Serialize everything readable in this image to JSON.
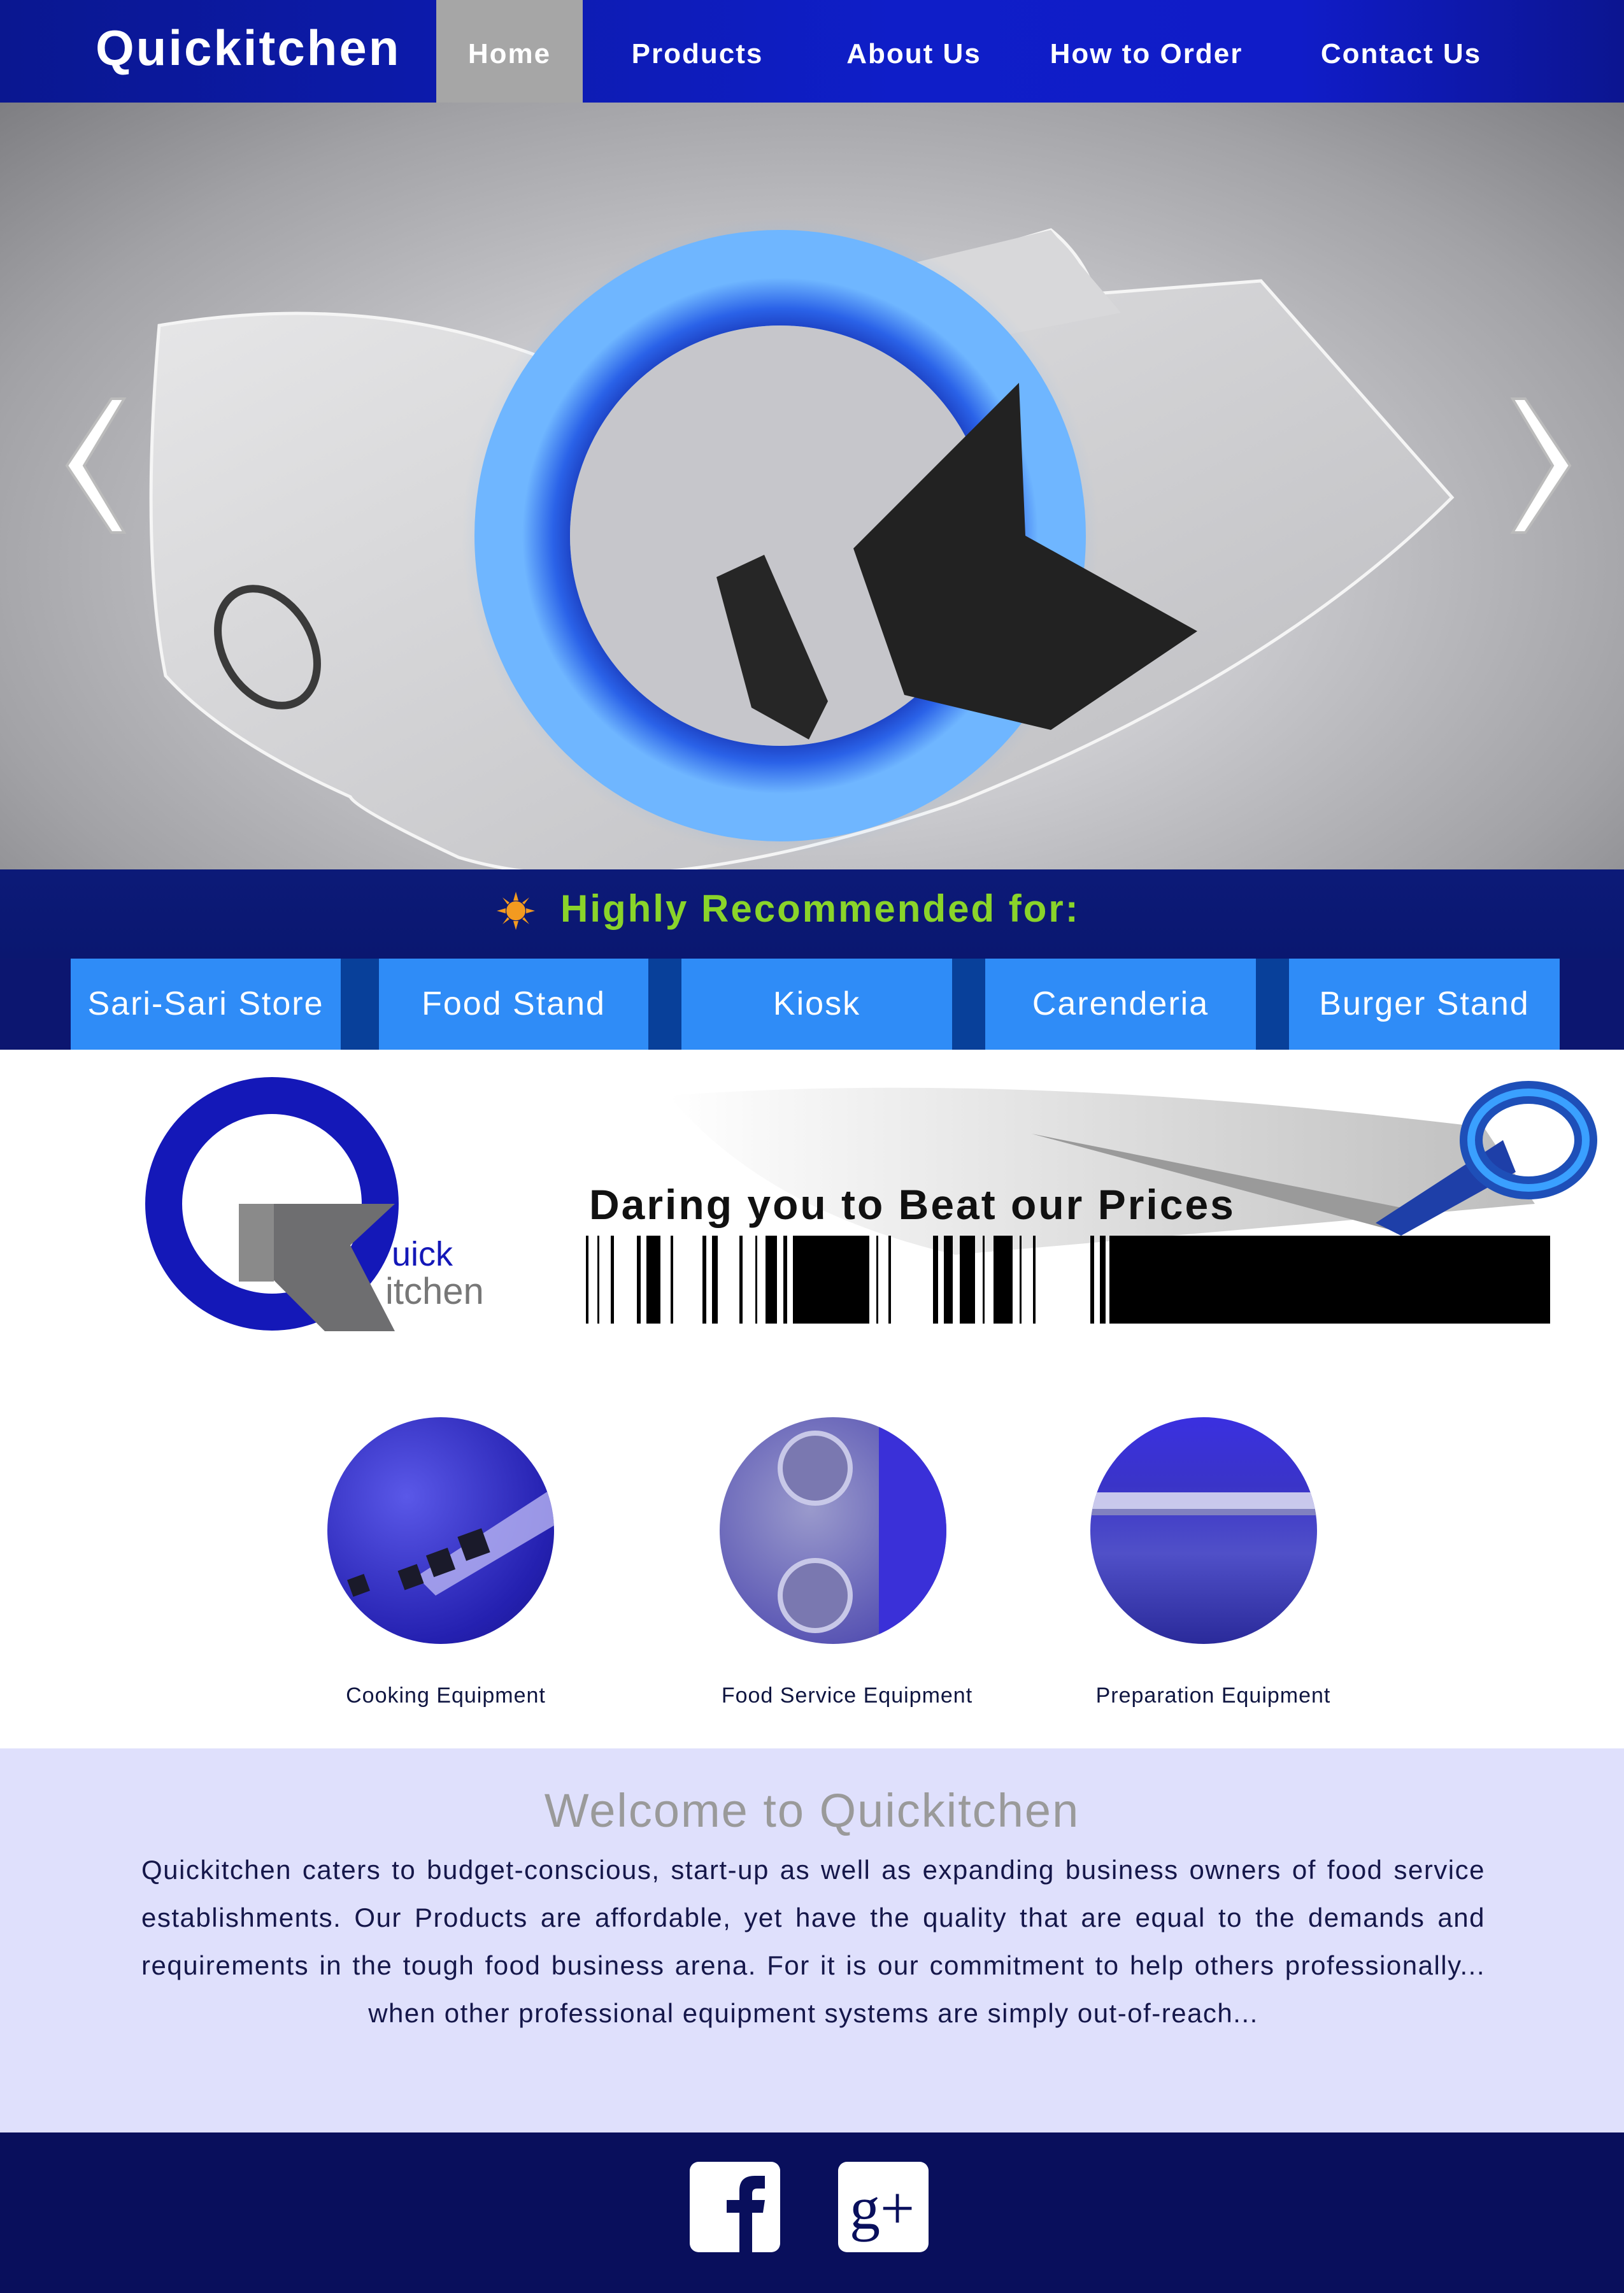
{
  "header": {
    "brand": "Quickitchen",
    "nav": [
      {
        "label": "Home",
        "active": true
      },
      {
        "label": "Products"
      },
      {
        "label": "About Us"
      },
      {
        "label": "How to Order"
      },
      {
        "label": "Contact Us"
      }
    ]
  },
  "hero": {
    "prev_icon": "chevron-left-icon",
    "next_icon": "chevron-right-icon"
  },
  "recommended": {
    "title": "Highly Recommended for:",
    "icon": "sun-icon",
    "items": [
      "Sari-Sari Store",
      "Food Stand",
      "Kiosk",
      "Carenderia",
      "Burger Stand"
    ]
  },
  "banner": {
    "logo_line1": "uick",
    "logo_line2": "itchen",
    "slogan": "Daring you to Beat our Prices"
  },
  "categories": [
    {
      "label": "Cooking Equipment"
    },
    {
      "label": "Food Service Equipment"
    },
    {
      "label": "Preparation Equipment"
    }
  ],
  "welcome": {
    "title": "Welcome to Quickitchen",
    "text": "Quickitchen caters to budget-conscious, start-up as well as expanding business owners of food service establishments. Our Products are affordable, yet have the quality that are equal to the demands and requirements in the tough food business arena. For it is our commitment to help others professionally... when other professional equipment systems are simply out-of-reach..."
  },
  "footer": {
    "social": [
      {
        "icon": "facebook-icon",
        "glyph": "f"
      },
      {
        "icon": "google-plus-icon",
        "glyph": "g+"
      }
    ]
  },
  "colors": {
    "nav_blue": "#0f1ec8",
    "nav_active": "#a6a6a6",
    "accent_green": "#8ad42a",
    "button_blue": "#2f8cf7",
    "welcome_bg": "#dfe0fc",
    "footer_bg": "#090f5c"
  }
}
